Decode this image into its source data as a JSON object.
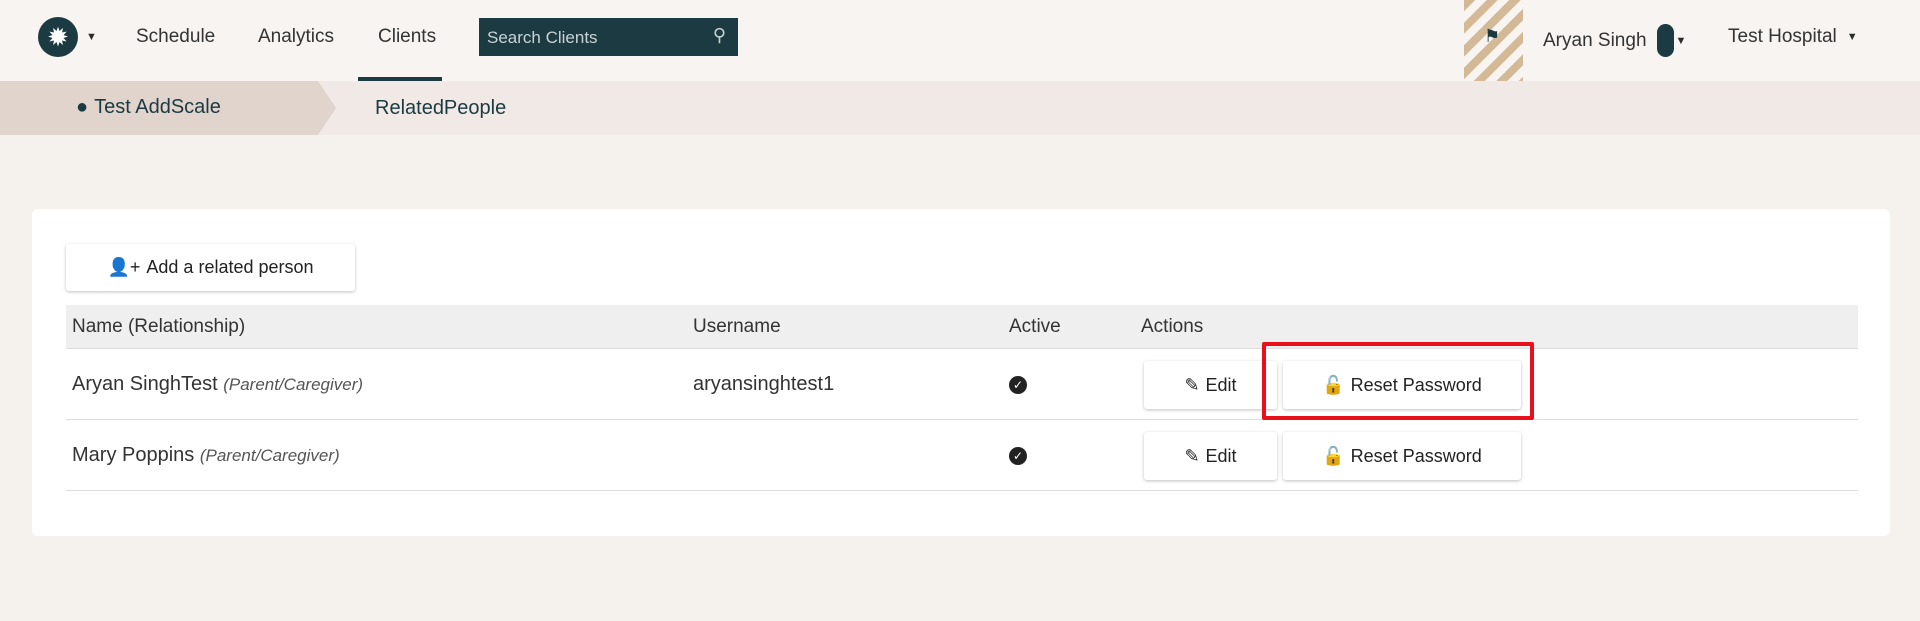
{
  "nav": {
    "items": [
      "Schedule",
      "Analytics",
      "Clients"
    ],
    "active": "Clients",
    "search_placeholder": "Search Clients",
    "user": "Aryan Singh",
    "org": "Test Hospital"
  },
  "breadcrumb": {
    "client": "Test AddScale",
    "page": "RelatedPeople"
  },
  "main": {
    "add_button": "Add a related person",
    "columns": [
      "Name (Relationship)",
      "Username",
      "Active",
      "Actions"
    ],
    "rows": [
      {
        "name": "Aryan SinghTest",
        "relationship": "(Parent/Caregiver)",
        "username": "aryansinghtest1",
        "active": true,
        "edit": "Edit",
        "reset": "Reset Password"
      },
      {
        "name": "Mary Poppins",
        "relationship": "(Parent/Caregiver)",
        "username": "",
        "active": true,
        "edit": "Edit",
        "reset": "Reset Password"
      }
    ]
  },
  "colors": {
    "brand": "#1b3a42",
    "highlight": "#e8101a"
  }
}
